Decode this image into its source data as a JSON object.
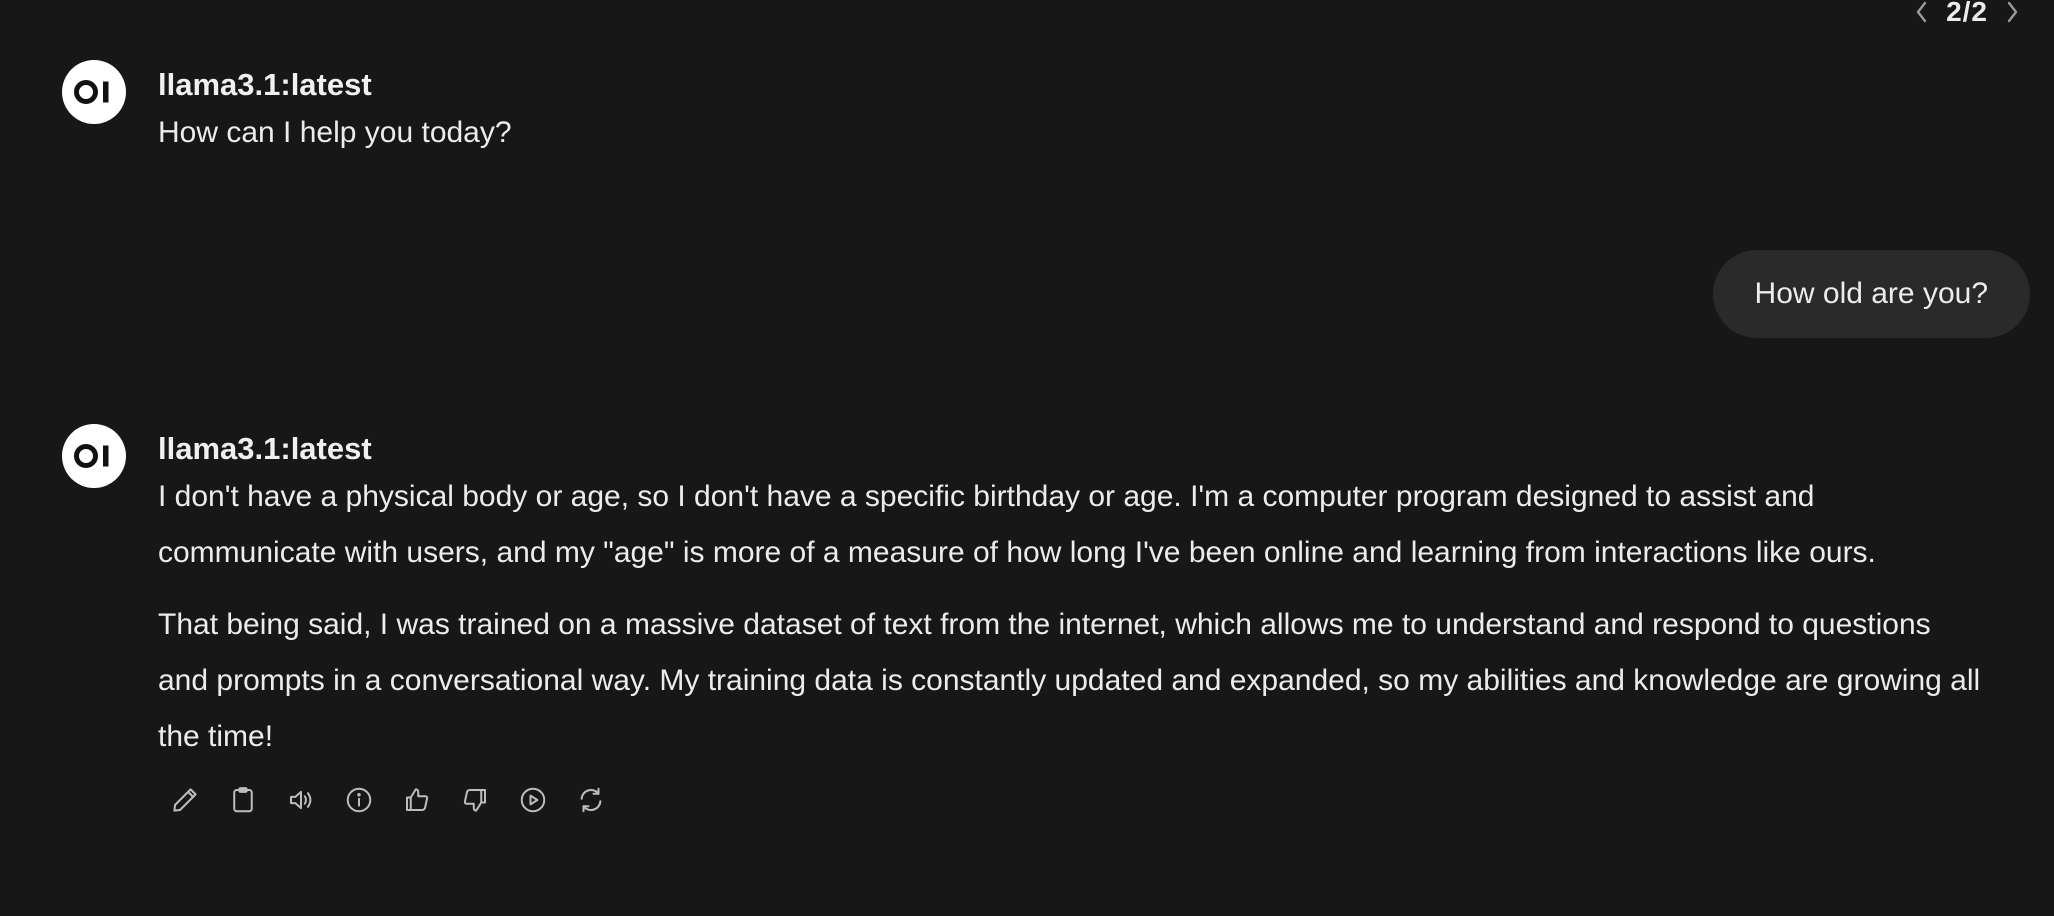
{
  "pager": {
    "label": "2/2"
  },
  "messages": [
    {
      "model": "llama3.1:latest",
      "paragraphs": [
        "How can I help you today?"
      ]
    },
    {
      "user": "How old are you?"
    },
    {
      "model": "llama3.1:latest",
      "paragraphs": [
        "I don't have a physical body or age, so I don't have a specific birthday or age. I'm a computer program designed to assist and communicate with users, and my \"age\" is more of a measure of how long I've been online and learning from interactions like ours.",
        "That being said, I was trained on a massive dataset of text from the internet, which allows me to understand and respond to questions and prompts in a conversational way. My training data is constantly updated and expanded, so my abilities and knowledge are growing all the time!"
      ]
    }
  ],
  "actions": [
    {
      "icon": "pencil-icon"
    },
    {
      "icon": "clipboard-icon"
    },
    {
      "icon": "speaker-icon"
    },
    {
      "icon": "info-icon"
    },
    {
      "icon": "thumbs-up-icon"
    },
    {
      "icon": "thumbs-down-icon"
    },
    {
      "icon": "play-circle-icon"
    },
    {
      "icon": "regenerate-icon"
    }
  ],
  "colors": {
    "background": "#171717",
    "bubble": "#2a2a2a",
    "text": "#ececec",
    "avatar": "#ffffff",
    "icon": "#bdbdbd"
  }
}
